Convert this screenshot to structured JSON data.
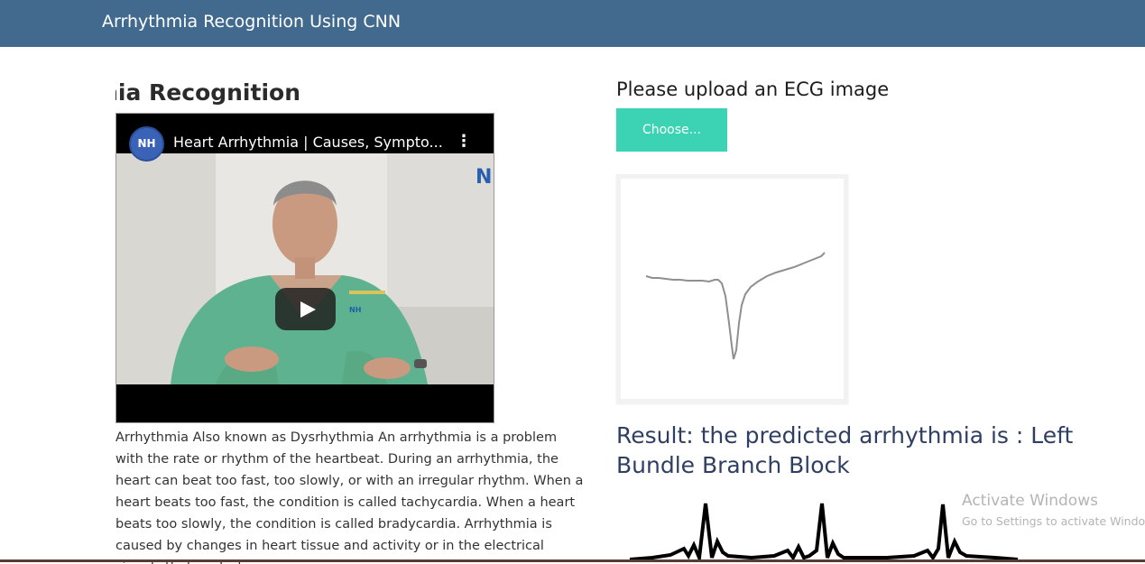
{
  "navbar": {
    "brand": "Arrhythmia Recognition Using CNN",
    "color": "#426a8f"
  },
  "left": {
    "section_title": "Arrhythmia Recognition",
    "video": {
      "title": "Heart Arrhythmia | Causes, Sympto...",
      "channel_logo_text": "NH",
      "corner_mark": "N",
      "play_icon": "play-icon",
      "menu_icon": "kebab-menu-icon"
    },
    "description": "Arrhythmia Also known as Dysrhythmia An arrhythmia is a problem with the rate or rhythm of the heartbeat. During an arrhythmia, the heart can beat too fast, too slowly, or with an irregular rhythm. When a heart beats too fast, the condition is called tachycardia. When a heart beats too slowly, the condition is called bradycardia. Arrhythmia is caused by changes in heart tissue and activity or in the electrical signals that control"
  },
  "right": {
    "upload_title": "Please upload an ECG image",
    "choose_button": "Choose...",
    "result_text": "Result: the predicted arrhythmia is : Left Bundle Branch Block"
  },
  "watermark": {
    "title": "Activate Windows",
    "subtitle": "Go to Settings to activate Windows."
  },
  "colors": {
    "accent": "#3bd3b4",
    "result_text": "#2f3e63"
  }
}
